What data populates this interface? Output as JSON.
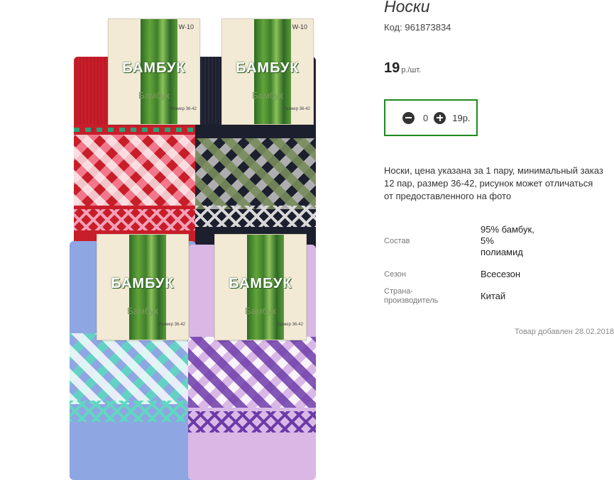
{
  "product": {
    "title": "Носки",
    "code_label": "Код:",
    "code": "961873834",
    "price_value": "19",
    "price_unit": "р./шт.",
    "quantity": "0",
    "sum": "19р.",
    "description": "Носки, цена указана за 1 пару, минимальный заказ 12 пар, размер 36-42, рисунок может отличаться от предоставленного на фото",
    "properties": [
      {
        "key": "Состав",
        "value": "95% бамбук, 5% полиамид"
      },
      {
        "key": "Сезон",
        "value": "Всесезон"
      },
      {
        "key": "Страна-производитель",
        "value": "Китай"
      }
    ],
    "added_text": "Товар добавлен 28.02.2018"
  },
  "photo": {
    "label_brand": "БАМБУК",
    "label_code": "W-10",
    "label_sub": "Бамбук",
    "label_size": "Размер 36-42",
    "sock_colors": {
      "red": "#c81e2a",
      "navy": "#1c1f2e",
      "blue": "#8ea6e2",
      "lilac": "#d9b8e6"
    },
    "accent_color": "#1e8a1e"
  }
}
